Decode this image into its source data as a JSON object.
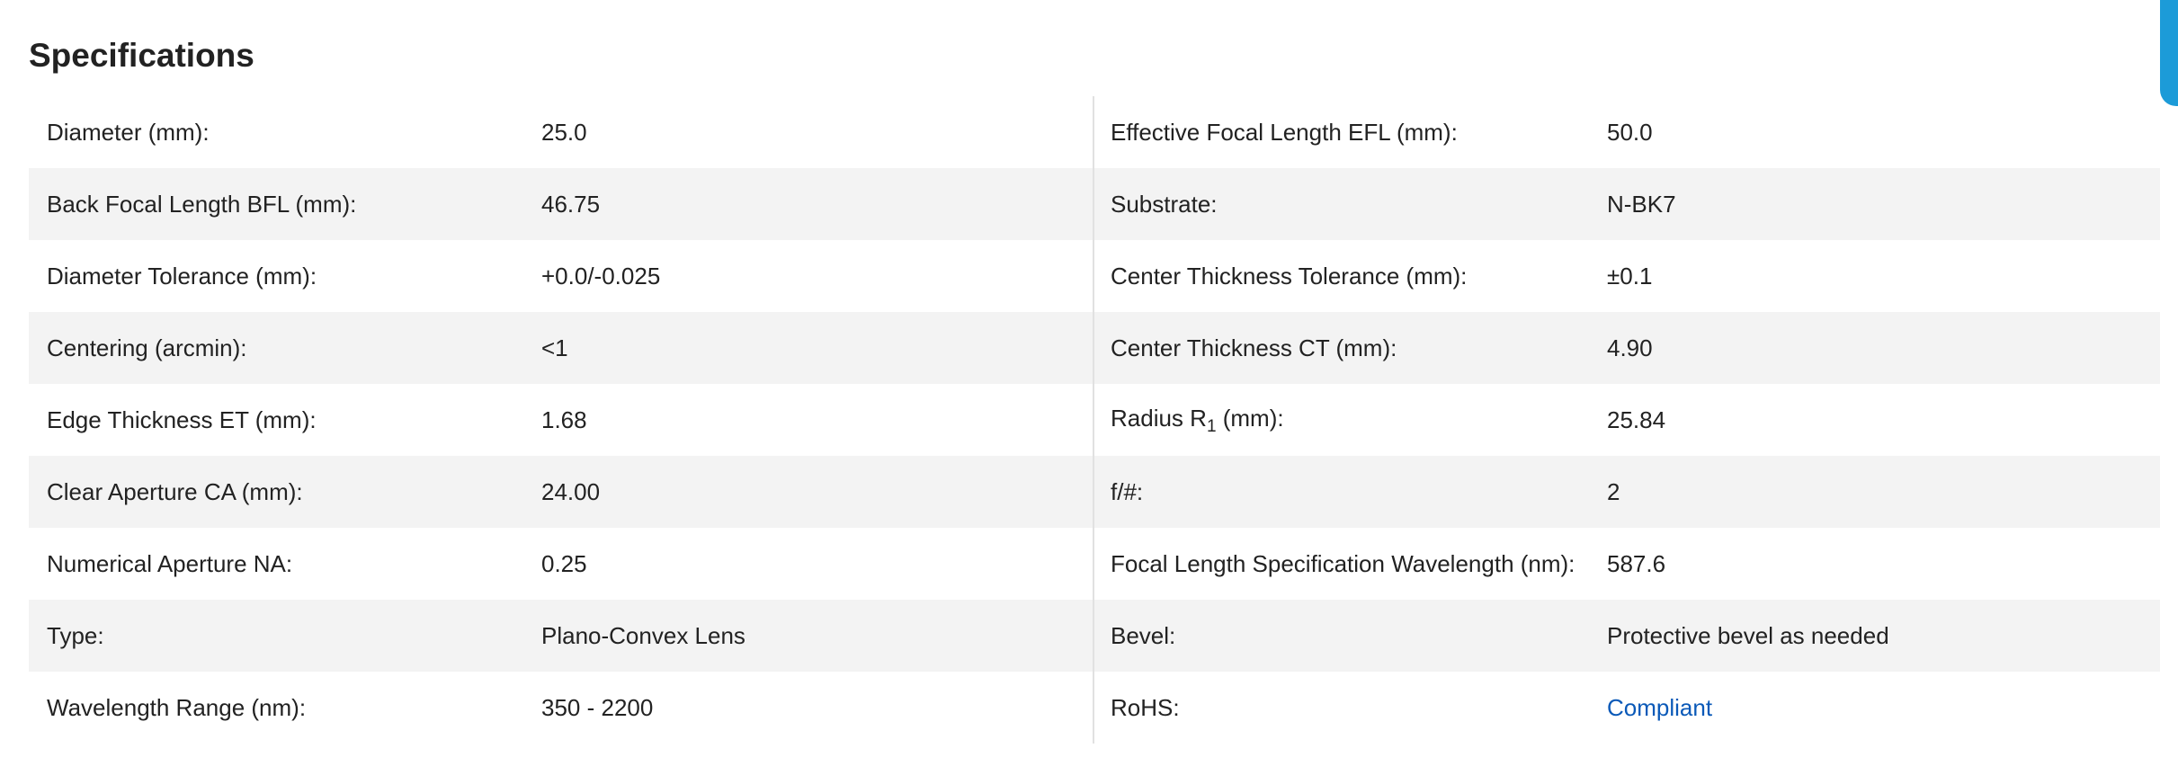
{
  "title": "Specifications",
  "left": [
    {
      "label": "Diameter (mm):",
      "value": "25.0"
    },
    {
      "label": "Back Focal Length BFL (mm):",
      "value": "46.75"
    },
    {
      "label": "Diameter Tolerance (mm):",
      "value": "+0.0/-0.025"
    },
    {
      "label": "Centering (arcmin):",
      "value": "<1"
    },
    {
      "label": "Edge Thickness ET (mm):",
      "value": "1.68"
    },
    {
      "label": "Clear Aperture CA (mm):",
      "value": "24.00"
    },
    {
      "label": "Numerical Aperture NA:",
      "value": "0.25"
    },
    {
      "label": "Type:",
      "value": "Plano-Convex Lens"
    },
    {
      "label": "Wavelength Range (nm):",
      "value": "350 - 2200"
    }
  ],
  "right": [
    {
      "label": "Effective Focal Length EFL (mm):",
      "value": "50.0"
    },
    {
      "label": "Substrate:",
      "value": "N-BK7"
    },
    {
      "label": "Center Thickness Tolerance (mm):",
      "value": "±0.1"
    },
    {
      "label": "Center Thickness CT (mm):",
      "value": "4.90"
    },
    {
      "label_prefix": "Radius R",
      "label_sub": "1",
      "label_suffix": " (mm):",
      "value": "25.84"
    },
    {
      "label": "f/#:",
      "value": "2"
    },
    {
      "label": "Focal Length Specification Wavelength (nm):",
      "value": "587.6"
    },
    {
      "label": "Bevel:",
      "value": "Protective bevel as needed"
    },
    {
      "label": "RoHS:",
      "value": "Compliant"
    }
  ],
  "colors": {
    "link": "#0a59b8",
    "row_stripe": "#f3f3f3",
    "edge_tab": "#1c9bd8"
  }
}
